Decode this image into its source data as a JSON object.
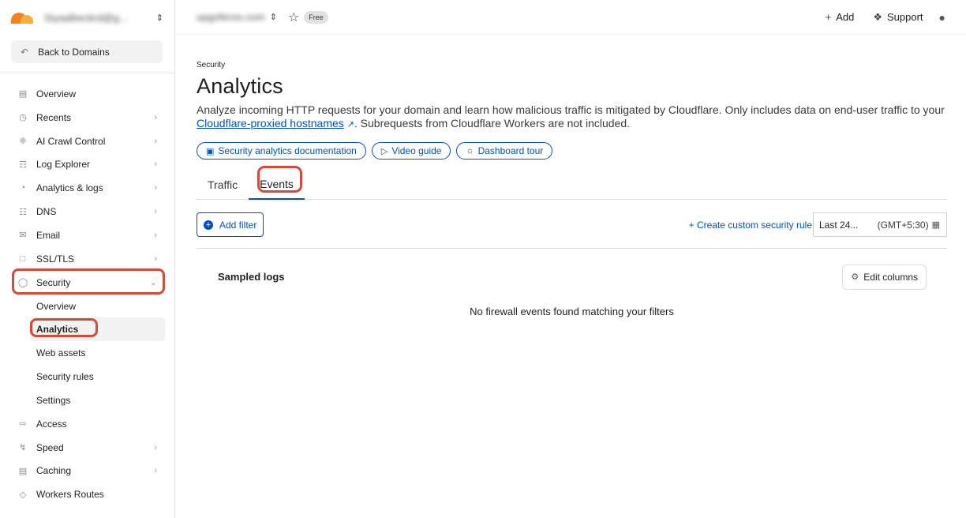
{
  "account": {
    "name": "Siyaalbeckrd@g...",
    "switch_icon": "updown-chevron-icon"
  },
  "sidebar": {
    "back_label": "Back to Domains",
    "items": [
      {
        "label": "Overview",
        "icon": "document-icon",
        "chevron": false
      },
      {
        "label": "Recents",
        "icon": "clock-icon",
        "chevron": true
      },
      {
        "label": "AI Crawl Control",
        "icon": "crawl-icon",
        "chevron": true
      },
      {
        "label": "Log Explorer",
        "icon": "log-icon",
        "chevron": true
      },
      {
        "label": "Analytics & logs",
        "icon": "chart-icon",
        "chevron": true
      },
      {
        "label": "DNS",
        "icon": "network-icon",
        "chevron": true
      },
      {
        "label": "Email",
        "icon": "mail-icon",
        "chevron": true
      },
      {
        "label": "SSL/TLS",
        "icon": "lock-icon",
        "chevron": true
      },
      {
        "label": "Security",
        "icon": "shield-icon",
        "chevron": true,
        "expanded": true
      }
    ],
    "security_sub": [
      {
        "label": "Overview"
      },
      {
        "label": "Analytics",
        "active": true
      },
      {
        "label": "Web assets"
      },
      {
        "label": "Security rules"
      },
      {
        "label": "Settings"
      }
    ],
    "items_after": [
      {
        "label": "Access",
        "icon": "access-icon",
        "chevron": false
      },
      {
        "label": "Speed",
        "icon": "bolt-icon",
        "chevron": true
      },
      {
        "label": "Caching",
        "icon": "cache-icon",
        "chevron": true
      },
      {
        "label": "Workers Routes",
        "icon": "code-icon",
        "chevron": false
      }
    ]
  },
  "topbar": {
    "domain": "upgoferoo.com",
    "plan": "Free",
    "add_label": "Add",
    "support_label": "Support"
  },
  "main": {
    "breadcrumb": "Security",
    "title": "Analytics",
    "desc_part1": "Analyze incoming HTTP requests for your domain and learn how malicious traffic is mitigated by Cloudflare. Only includes data on end-user traffic to your ",
    "desc_link": "Cloudflare-proxied hostnames",
    "desc_part2": ". Subrequests from Cloudflare Workers are not included.",
    "pills": [
      {
        "label": "Security analytics documentation",
        "icon": "book-icon"
      },
      {
        "label": "Video guide",
        "icon": "play-icon"
      },
      {
        "label": "Dashboard tour",
        "icon": "lightbulb-icon"
      }
    ],
    "tabs": [
      {
        "label": "Traffic",
        "active": false
      },
      {
        "label": "Events",
        "active": true
      }
    ],
    "add_filter_label": "Add filter",
    "create_rule_label": "Create custom security rule",
    "date_range": "Last 24...",
    "timezone": "(GMT+5:30)",
    "logs_title": "Sampled logs",
    "edit_columns_label": "Edit columns",
    "empty_message": "No firewall events found matching your filters"
  },
  "colors": {
    "accent": "#0051c3",
    "highlight": "#d64a3a",
    "brand_orange": "#f48120"
  }
}
